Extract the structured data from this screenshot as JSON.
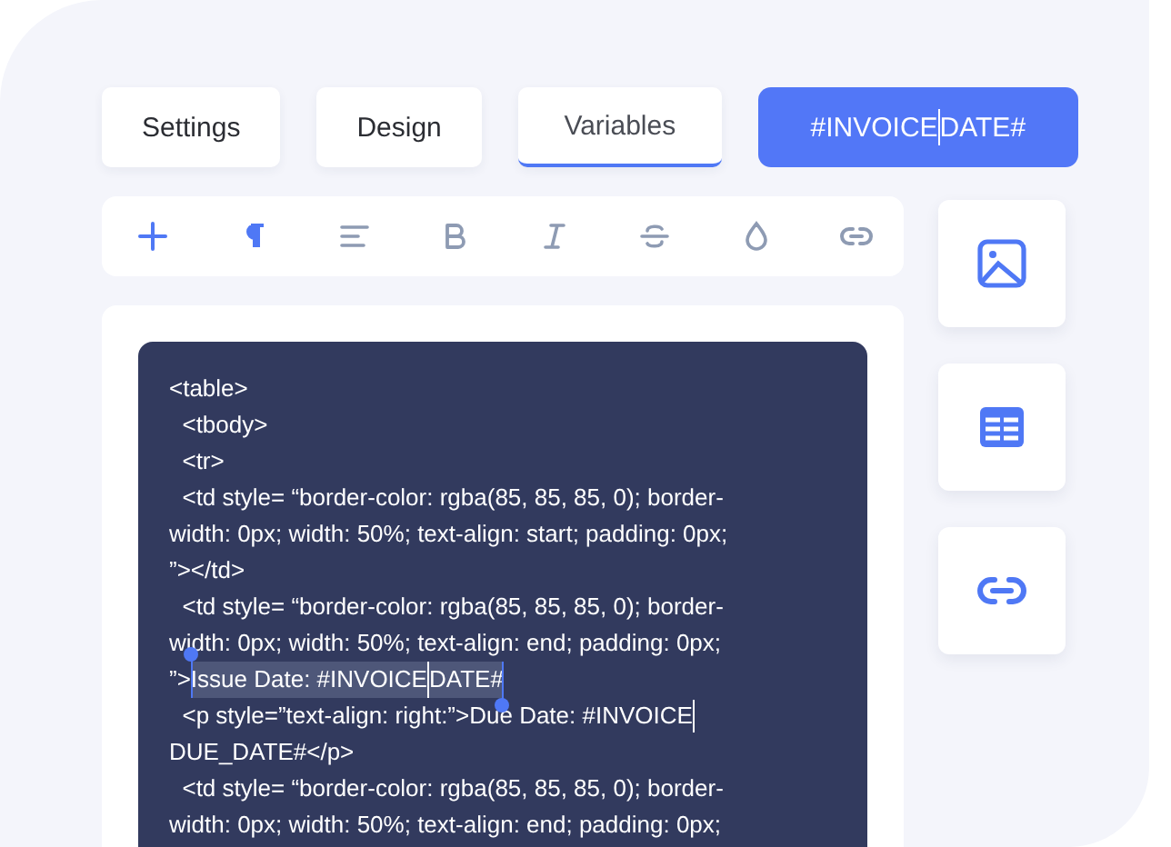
{
  "tabs": [
    {
      "label": "Settings",
      "selected": false
    },
    {
      "label": "Design",
      "selected": false
    },
    {
      "label": "Variables",
      "selected": true
    }
  ],
  "variable_button": {
    "parts": [
      {
        "kind": "text",
        "text": "#INVOICE"
      },
      {
        "kind": "caret"
      },
      {
        "kind": "text",
        "text": "DATE#"
      }
    ]
  },
  "toolbar": [
    {
      "kind": "plus",
      "active": true
    },
    {
      "kind": "pilcrow",
      "active": true
    },
    {
      "kind": "align-left",
      "active": false
    },
    {
      "kind": "bold",
      "active": false
    },
    {
      "kind": "italic",
      "active": false
    },
    {
      "kind": "strikethrough",
      "active": false
    },
    {
      "kind": "drop",
      "active": false
    },
    {
      "kind": "link",
      "active": false
    }
  ],
  "code_lines": [
    {
      "parts": [
        {
          "kind": "text",
          "text": "<table>"
        }
      ]
    },
    {
      "parts": [
        {
          "kind": "text",
          "text": "  <tbody>"
        }
      ]
    },
    {
      "parts": [
        {
          "kind": "text",
          "text": "  <tr>"
        }
      ]
    },
    {
      "parts": [
        {
          "kind": "text",
          "text": "  <td style= “border-color: rgba(85, 85, 85, 0); border-"
        }
      ]
    },
    {
      "parts": [
        {
          "kind": "text",
          "text": "width: 0px; width: 50%; text-align: start; padding: 0px;"
        }
      ]
    },
    {
      "parts": [
        {
          "kind": "text",
          "text": "”></td>"
        }
      ]
    },
    {
      "parts": [
        {
          "kind": "text",
          "text": "  <td style= “border-color: rgba(85, 85, 85, 0); border-"
        }
      ]
    },
    {
      "parts": [
        {
          "kind": "text",
          "text": "width: 0px; width: 50%; text-align: end; padding: 0px;"
        }
      ]
    },
    {
      "parts": [
        {
          "kind": "text",
          "text": "”>"
        },
        {
          "kind": "selection",
          "text": "Issue Date: #INVOICE"
        },
        {
          "kind": "caret"
        },
        {
          "kind": "selection",
          "text": "DATE#"
        }
      ]
    },
    {
      "parts": [
        {
          "kind": "text",
          "text": "  <p style=”text-align: right:”>Due Date: #INVOICE"
        },
        {
          "kind": "caret"
        }
      ]
    },
    {
      "parts": [
        {
          "kind": "text",
          "text": "DUE_DATE#</p>"
        }
      ]
    },
    {
      "parts": [
        {
          "kind": "text",
          "text": "  <td style= “border-color: rgba(85, 85, 85, 0); border-"
        }
      ]
    },
    {
      "parts": [
        {
          "kind": "text",
          "text": "width: 0px; width: 50%; text-align: end; padding: 0px;"
        }
      ]
    }
  ],
  "side_buttons": [
    {
      "kind": "image"
    },
    {
      "kind": "table"
    },
    {
      "kind": "link"
    }
  ]
}
